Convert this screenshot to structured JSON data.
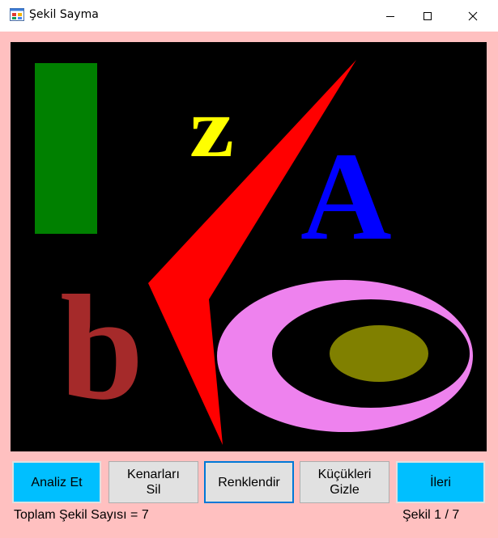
{
  "window": {
    "title": "Şekil Sayma",
    "controls": [
      "minimize",
      "maximize",
      "close"
    ]
  },
  "canvas": {
    "background": "#000000",
    "letters": [
      {
        "text": "Z",
        "color": "#ffff00"
      },
      {
        "text": "A",
        "color": "#0000ff"
      },
      {
        "text": "b",
        "color": "#a52a2a"
      }
    ],
    "shapes": [
      {
        "kind": "rectangle",
        "color": "#008000"
      },
      {
        "kind": "arrow",
        "color": "#ff0000"
      },
      {
        "kind": "ellipse-ring",
        "color": "#ee82ee"
      },
      {
        "kind": "ellipse",
        "color": "#808000"
      }
    ]
  },
  "buttons": {
    "analyze": "Analiz Et",
    "remove_edges": "Kenarları\nSil",
    "colorize": "Renklendir",
    "hide_small": "Küçükleri\nGizle",
    "next": "İleri"
  },
  "status": {
    "total": "Toplam Şekil Sayısı = 7",
    "index": "Şekil 1 / 7"
  },
  "colors": {
    "form_background": "#ffc0c0",
    "accent_button": "#00bfff",
    "focus_border": "#0078d7"
  }
}
